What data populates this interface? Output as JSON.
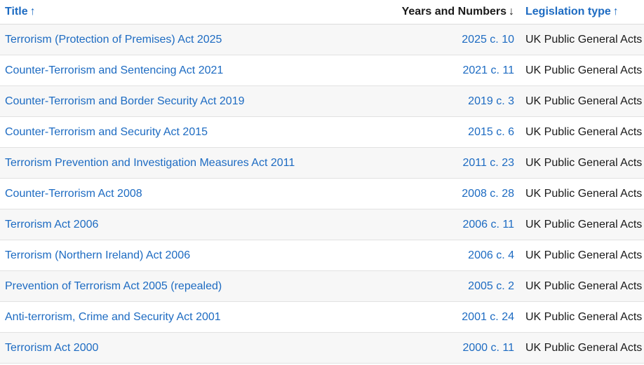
{
  "header": {
    "title_label": "Title",
    "title_sort_icon": "↑",
    "year_label": "Years and Numbers",
    "year_sort_icon": "↓",
    "type_label": "Legislation type",
    "type_sort_icon": "↑"
  },
  "colors": {
    "link": "#1d6bc2",
    "text": "#1a1a1a",
    "row_alt": "#f7f7f7"
  },
  "rows": [
    {
      "title": "Terrorism (Protection of Premises) Act 2025",
      "year": "2025 c. 10",
      "type": "UK Public General Acts"
    },
    {
      "title": "Counter-Terrorism and Sentencing Act 2021",
      "year": "2021 c. 11",
      "type": "UK Public General Acts"
    },
    {
      "title": "Counter-Terrorism and Border Security Act 2019",
      "year": "2019 c. 3",
      "type": "UK Public General Acts"
    },
    {
      "title": "Counter-Terrorism and Security Act 2015",
      "year": "2015 c. 6",
      "type": "UK Public General Acts"
    },
    {
      "title": "Terrorism Prevention and Investigation Measures Act 2011",
      "year": "2011 c. 23",
      "type": "UK Public General Acts"
    },
    {
      "title": "Counter-Terrorism Act 2008",
      "year": "2008 c. 28",
      "type": "UK Public General Acts"
    },
    {
      "title": "Terrorism Act 2006",
      "year": "2006 c. 11",
      "type": "UK Public General Acts"
    },
    {
      "title": "Terrorism (Northern Ireland) Act 2006",
      "year": "2006 c. 4",
      "type": "UK Public General Acts"
    },
    {
      "title": "Prevention of Terrorism Act 2005 (repealed)",
      "year": "2005 c. 2",
      "type": "UK Public General Acts"
    },
    {
      "title": "Anti-terrorism, Crime and Security Act 2001",
      "year": "2001 c. 24",
      "type": "UK Public General Acts"
    },
    {
      "title": "Terrorism Act 2000",
      "year": "2000 c. 11",
      "type": "UK Public General Acts"
    }
  ]
}
